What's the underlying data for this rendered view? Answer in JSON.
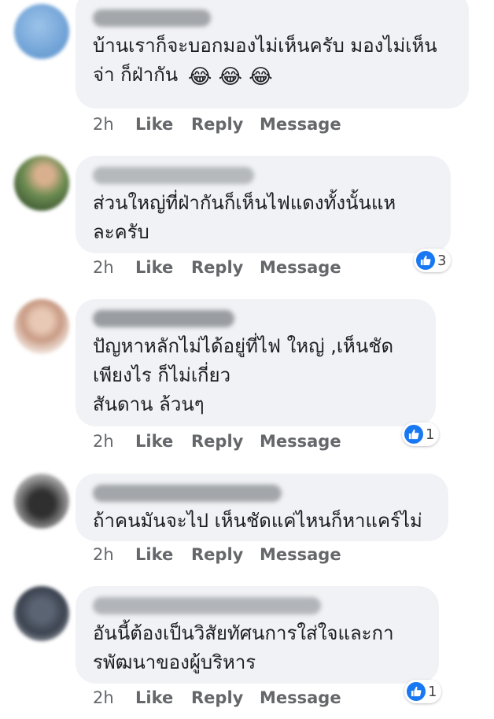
{
  "colors": {
    "bubble": "#f0f2f5",
    "actions": "#65676b",
    "like_blue": "#1877f2"
  },
  "comments": [
    {
      "text": "บ้านเราก็จะบอกมองไม่เห็นครับ มองไม่เห็น\nจ่า ก็ฝ่ากัน",
      "emojis": "😂 😂 😂",
      "time": "2h",
      "like": "Like",
      "reply": "Reply",
      "message": "Message",
      "reactions": ""
    },
    {
      "text": "ส่วนใหญ่ที่ฝ่ากันก็เห็นไฟแดงทั้งนั้นแห\nละครับ",
      "time": "2h",
      "like": "Like",
      "reply": "Reply",
      "message": "Message",
      "reactions": "3"
    },
    {
      "text": "ปัญหาหลักไม่ได้อยู่ที่ไฟ   ใหญ่ ,เห็นชัด\nเพียงไร ก็ไม่เกี่ยว\nสันดาน ล้วนๆ",
      "time": "2h",
      "like": "Like",
      "reply": "Reply",
      "message": "Message",
      "reactions": "1"
    },
    {
      "text": "ถ้าคนมันจะไป เห็นชัดแค่ไหนก็หาแคร์ไม่",
      "time": "2h",
      "like": "Like",
      "reply": "Reply",
      "message": "Message",
      "reactions": ""
    },
    {
      "text": "อันนี้ต้องเป็นวิสัยทัศนการใส่ใจและกา\nรพัฒนาของผู้บริหาร",
      "time": "2h",
      "like": "Like",
      "reply": "Reply",
      "message": "Message",
      "reactions": "1"
    }
  ]
}
